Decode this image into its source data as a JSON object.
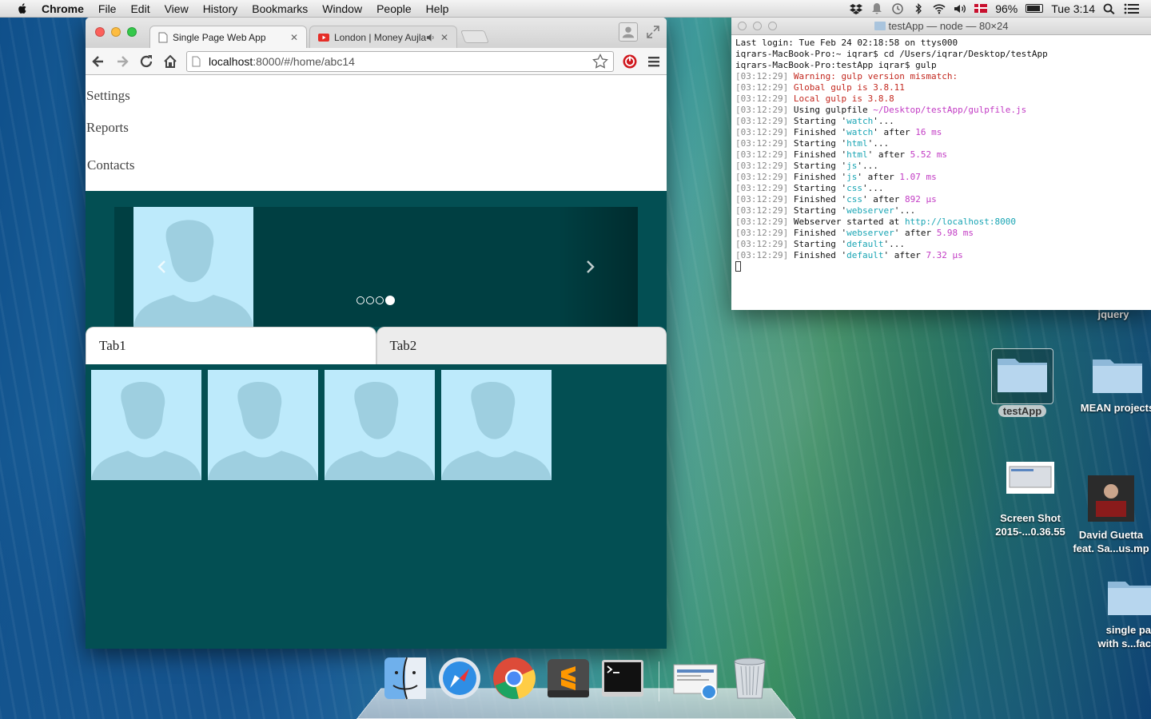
{
  "menubar": {
    "items": [
      "Chrome",
      "File",
      "Edit",
      "View",
      "History",
      "Bookmarks",
      "Window",
      "People",
      "Help"
    ],
    "battery": "96%",
    "clock": "Tue 3:14"
  },
  "browser": {
    "tabs": [
      {
        "title": "Single Page Web App",
        "icon": "page-icon"
      },
      {
        "title": "London | Money Aujla F",
        "icon": "youtube-icon"
      }
    ],
    "url_host": "localhost",
    "url_path": ":8000/#/home/abc14"
  },
  "page": {
    "nav": [
      "Settings",
      "Reports",
      "Contacts"
    ],
    "carousel": {
      "slide_count": 4,
      "active_index": 3
    },
    "tabs": [
      "Tab1",
      "Tab2"
    ],
    "thumbnail_count": 4,
    "colors": {
      "background": "#034f53",
      "avatar_bg": "#bdeafb",
      "avatar_fg": "#9ecfe0"
    }
  },
  "terminal": {
    "title": "testApp — node — 80×24",
    "lines": [
      {
        "parts": [
          {
            "t": "Last login: Tue Feb 24 02:18:58 on ttys000",
            "c": ""
          }
        ]
      },
      {
        "parts": [
          {
            "t": "iqrars-MacBook-Pro:~ iqrar$ cd /Users/iqrar/Desktop/testApp",
            "c": ""
          }
        ]
      },
      {
        "parts": [
          {
            "t": "iqrars-MacBook-Pro:testApp iqrar$ gulp",
            "c": ""
          }
        ]
      },
      {
        "parts": [
          {
            "t": "[03:12:29]",
            "c": "ts"
          },
          {
            "t": " Warning: gulp version mismatch:",
            "c": "r"
          }
        ]
      },
      {
        "parts": [
          {
            "t": "[03:12:29]",
            "c": "ts"
          },
          {
            "t": " Global gulp is 3.8.11",
            "c": "r"
          }
        ]
      },
      {
        "parts": [
          {
            "t": "[03:12:29]",
            "c": "ts"
          },
          {
            "t": " Local gulp is 3.8.8",
            "c": "r"
          }
        ]
      },
      {
        "parts": [
          {
            "t": "[03:12:29]",
            "c": "ts"
          },
          {
            "t": " Using gulpfile ",
            "c": ""
          },
          {
            "t": "~/Desktop/testApp/gulpfile.js",
            "c": "m"
          }
        ]
      },
      {
        "parts": [
          {
            "t": "[03:12:29]",
            "c": "ts"
          },
          {
            "t": " Starting '",
            "c": ""
          },
          {
            "t": "watch",
            "c": "c"
          },
          {
            "t": "'...",
            "c": ""
          }
        ]
      },
      {
        "parts": [
          {
            "t": "[03:12:29]",
            "c": "ts"
          },
          {
            "t": " Finished '",
            "c": ""
          },
          {
            "t": "watch",
            "c": "c"
          },
          {
            "t": "' after ",
            "c": ""
          },
          {
            "t": "16 ms",
            "c": "m"
          }
        ]
      },
      {
        "parts": [
          {
            "t": "[03:12:29]",
            "c": "ts"
          },
          {
            "t": " Starting '",
            "c": ""
          },
          {
            "t": "html",
            "c": "c"
          },
          {
            "t": "'...",
            "c": ""
          }
        ]
      },
      {
        "parts": [
          {
            "t": "[03:12:29]",
            "c": "ts"
          },
          {
            "t": " Finished '",
            "c": ""
          },
          {
            "t": "html",
            "c": "c"
          },
          {
            "t": "' after ",
            "c": ""
          },
          {
            "t": "5.52 ms",
            "c": "m"
          }
        ]
      },
      {
        "parts": [
          {
            "t": "[03:12:29]",
            "c": "ts"
          },
          {
            "t": " Starting '",
            "c": ""
          },
          {
            "t": "js",
            "c": "c"
          },
          {
            "t": "'...",
            "c": ""
          }
        ]
      },
      {
        "parts": [
          {
            "t": "[03:12:29]",
            "c": "ts"
          },
          {
            "t": " Finished '",
            "c": ""
          },
          {
            "t": "js",
            "c": "c"
          },
          {
            "t": "' after ",
            "c": ""
          },
          {
            "t": "1.07 ms",
            "c": "m"
          }
        ]
      },
      {
        "parts": [
          {
            "t": "[03:12:29]",
            "c": "ts"
          },
          {
            "t": " Starting '",
            "c": ""
          },
          {
            "t": "css",
            "c": "c"
          },
          {
            "t": "'...",
            "c": ""
          }
        ]
      },
      {
        "parts": [
          {
            "t": "[03:12:29]",
            "c": "ts"
          },
          {
            "t": " Finished '",
            "c": ""
          },
          {
            "t": "css",
            "c": "c"
          },
          {
            "t": "' after ",
            "c": ""
          },
          {
            "t": "892 μs",
            "c": "m"
          }
        ]
      },
      {
        "parts": [
          {
            "t": "[03:12:29]",
            "c": "ts"
          },
          {
            "t": " Starting '",
            "c": ""
          },
          {
            "t": "webserver",
            "c": "c"
          },
          {
            "t": "'...",
            "c": ""
          }
        ]
      },
      {
        "parts": [
          {
            "t": "[03:12:29]",
            "c": "ts"
          },
          {
            "t": " Webserver started at ",
            "c": ""
          },
          {
            "t": "http://localhost:8000",
            "c": "c"
          }
        ]
      },
      {
        "parts": [
          {
            "t": "[03:12:29]",
            "c": "ts"
          },
          {
            "t": " Finished '",
            "c": ""
          },
          {
            "t": "webserver",
            "c": "c"
          },
          {
            "t": "' after ",
            "c": ""
          },
          {
            "t": "5.98 ms",
            "c": "m"
          }
        ]
      },
      {
        "parts": [
          {
            "t": "[03:12:29]",
            "c": "ts"
          },
          {
            "t": " Starting '",
            "c": ""
          },
          {
            "t": "default",
            "c": "c"
          },
          {
            "t": "'...",
            "c": ""
          }
        ]
      },
      {
        "parts": [
          {
            "t": "[03:12:29]",
            "c": "ts"
          },
          {
            "t": " Finished '",
            "c": ""
          },
          {
            "t": "default",
            "c": "c"
          },
          {
            "t": "' after ",
            "c": ""
          },
          {
            "t": "7.32 μs",
            "c": "m"
          }
        ]
      }
    ]
  },
  "desktop": {
    "jquery_label": "jquery",
    "testapp_label": "testApp",
    "mean_label": "MEAN projects",
    "screenshot_label_1": "Screen Shot",
    "screenshot_label_2": "2015-...0.36.55",
    "music_label_1": "David Guetta",
    "music_label_2": "feat. Sa...us.mp",
    "spa_label_1": "single pa",
    "spa_label_2": "with s...fac"
  },
  "dock": {
    "apps": [
      "finder-icon",
      "safari-icon",
      "chrome-icon",
      "sublime-icon",
      "terminal-icon",
      "preview-icon",
      "trash-icon"
    ]
  }
}
